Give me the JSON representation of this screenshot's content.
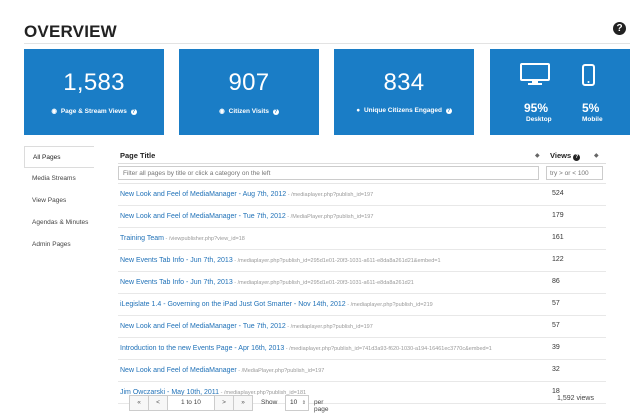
{
  "header": {
    "title": "OVERVIEW",
    "help": "?"
  },
  "tiles": [
    {
      "value": "1,583",
      "label": "Page & Stream Views",
      "icon": "eye-icon"
    },
    {
      "value": "907",
      "label": "Citizen Visits",
      "icon": "eye-icon"
    },
    {
      "value": "834",
      "label": "Unique Citizens Engaged",
      "icon": "user-icon"
    }
  ],
  "devices": {
    "desktop_pct": "95%",
    "desktop_label": "Desktop",
    "mobile_pct": "5%",
    "mobile_label": "Mobile",
    "desktop_share": 0.95,
    "mobile_share": 0.05
  },
  "sidebar": {
    "items": [
      {
        "label": "All Pages",
        "active": true
      },
      {
        "label": "Media Streams",
        "active": false
      },
      {
        "label": "View Pages",
        "active": false
      },
      {
        "label": "Agendas & Minutes",
        "active": false
      },
      {
        "label": "Admin Pages",
        "active": false
      }
    ]
  },
  "table": {
    "col_title": "Page Title",
    "col_views": "Views",
    "filter_title_placeholder": "Filter all pages by title or click a category on the left",
    "filter_views_placeholder": "try > or < 100",
    "rows": [
      {
        "title": "New Look and Feel of MediaManager - Aug 7th, 2012",
        "url": "/mediaplayer.php?publish_id=197",
        "views": "524"
      },
      {
        "title": "New Look and Feel of MediaManager - Tue 7th, 2012",
        "url": "/MediaPlayer.php?publish_id=197",
        "views": "179"
      },
      {
        "title": "Training Team",
        "url": "/viewpublisher.php?view_id=18",
        "views": "161"
      },
      {
        "title": "New Events Tab Info - Jun 7th, 2013",
        "url": "/mediaplayer.php?publish_id=295d1e01-20f3-1031-a611-e8da8a261d21&embed=1",
        "views": "122"
      },
      {
        "title": "New Events Tab Info - Jun 7th, 2013",
        "url": "/mediaplayer.php?publish_id=295d1e01-20f3-1031-a611-e8da8a261d21",
        "views": "86"
      },
      {
        "title": "iLegislate 1.4 - Governing on the iPad Just Got Smarter - Nov 14th, 2012",
        "url": "/mediaplayer.php?publish_id=219",
        "views": "57"
      },
      {
        "title": "New Look and Feel of MediaManager - Tue 7th, 2012",
        "url": "/mediaplayer.php?publish_id=197",
        "views": "57"
      },
      {
        "title": "Introduction to the new Events Page - Apr 16th, 2013",
        "url": "/mediaplayer.php?publish_id=741d3a93-f620-1030-a194-16461ec3770c&embed=1",
        "views": "39"
      },
      {
        "title": "New Look and Feel of MediaManager",
        "url": "/MediaPlayer.php?publish_id=197",
        "views": "32"
      },
      {
        "title": "Jim Owczarski - May 10th, 2011",
        "url": "/mediaplayer.php?publish_id=181",
        "views": "18"
      }
    ]
  },
  "pager": {
    "first": "«",
    "prev": "<",
    "range": "1 to 10",
    "next": ">",
    "last": "»",
    "show": "Show",
    "per_value": "10",
    "per_page": "per page",
    "total": "1,592 views"
  }
}
